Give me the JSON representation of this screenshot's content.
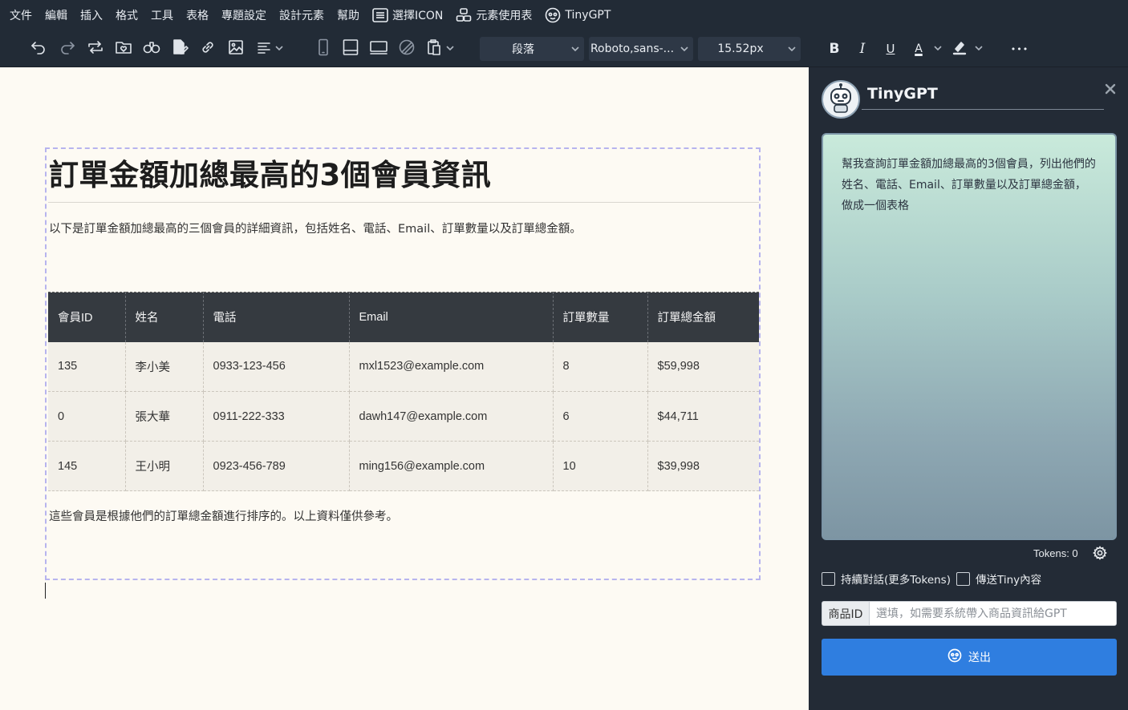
{
  "menubar": {
    "items": [
      "文件",
      "編輯",
      "插入",
      "格式",
      "工具",
      "表格",
      "專題設定",
      "設計元素",
      "幫助"
    ],
    "select_icon_label": "選擇ICON",
    "element_usage_label": "元素使用表",
    "tinygpt_label": "TinyGPT"
  },
  "toolbar": {
    "block_format": "段落",
    "font_family": "Roboto,sans-...",
    "font_size": "15.52px",
    "bold": "B",
    "italic": "I",
    "underline": "U",
    "text_color_glyph": "A",
    "more": "•••"
  },
  "document": {
    "title": "訂單金額加總最高的3個會員資訊",
    "intro": "以下是訂單金額加總最高的三個會員的詳細資訊，包括姓名、電話、Email、訂單數量以及訂單總金額。",
    "table": {
      "headers": [
        "會員ID",
        "姓名",
        "電話",
        "Email",
        "訂單數量",
        "訂單總金額"
      ],
      "rows": [
        [
          "135",
          "李小美",
          "0933-123-456",
          "mxl1523@example.com",
          "8",
          "$59,998"
        ],
        [
          "0",
          "張大華",
          "0911-222-333",
          "dawh147@example.com",
          "6",
          "$44,711"
        ],
        [
          "145",
          "王小明",
          "0923-456-789",
          "ming156@example.com",
          "10",
          "$39,998"
        ]
      ]
    },
    "outro": "這些會員是根據他們的訂單總金額進行排序的。以上資料僅供參考。"
  },
  "panel": {
    "title": "TinyGPT",
    "prompt_text": "幫我查詢訂單金額加總最高的3個會員，列出他們的姓名、電話、Email、訂單數量以及訂單總金額， 做成一個表格",
    "tokens_label": "Tokens: 0",
    "continue_chat_label": "持續對話(更多Tokens)",
    "send_tiny_content_label": "傳送Tiny內容",
    "product_id_label": "商品ID",
    "product_id_placeholder": "選填，如需要系統帶入商品資訊給GPT",
    "send_label": "送出"
  },
  "colors": {
    "chrome": "#222b36",
    "editor_bg": "#fdfaf3",
    "table_header": "#353a40",
    "send_button": "#2f7ee0"
  }
}
